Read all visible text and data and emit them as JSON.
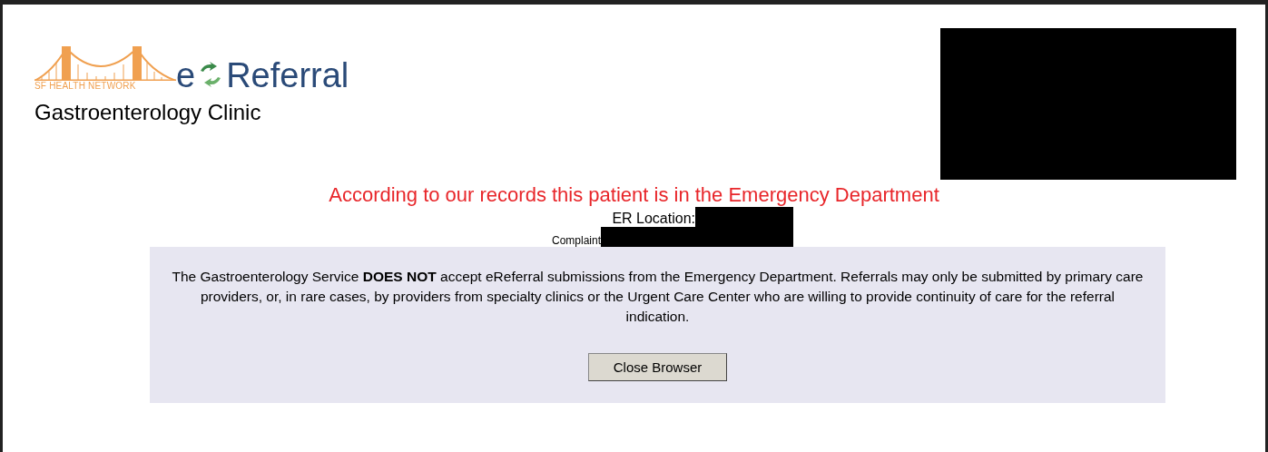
{
  "logo": {
    "network": "SF HEALTH NETWORK",
    "prefix": "e",
    "name": "Referral"
  },
  "clinic": "Gastroenterology Clinic",
  "alert": "According to our records this patient is in the Emergency Department",
  "fields": [
    {
      "label": "ER Location:",
      "kind": "large"
    },
    {
      "label": "Complaint",
      "kind": "small"
    }
  ],
  "notice": "The Gastroenterology Service **DOES NOT** accept eReferral submissions from the Emergency Department. Referrals may only be submitted by primary care providers, or, in rare cases, by providers from specialty clinics or the Urgent Care Center who are willing to provide continuity of care for the referral indication.",
  "button": "Close Browser"
}
